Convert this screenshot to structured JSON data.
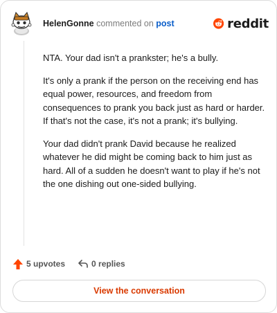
{
  "header": {
    "username": "HelenGonne",
    "action_text": "commented on",
    "post_link": "post",
    "logo_wordmark": "reddit"
  },
  "comment": {
    "paragraphs": [
      "NTA. Your dad isn't a prankster; he's a bully.",
      "It's only a prank if the person on the receiving end has equal power, resources, and freedom from consequences to prank you back just as hard or harder. If that's not the case, it's not a prank; it's bullying.",
      "Your dad didn't prank David because he realized whatever he did might be coming back to him just as hard. All of a sudden he doesn't want to play if he's not the one dishing out one-sided bullying."
    ]
  },
  "actions": {
    "upvotes_label": "5 upvotes",
    "replies_label": "0 replies"
  },
  "footer": {
    "view_button_label": "View the conversation"
  },
  "colors": {
    "reddit_orange": "#ff4500",
    "link_blue": "#0a5ec9",
    "button_text": "#d93a00"
  }
}
